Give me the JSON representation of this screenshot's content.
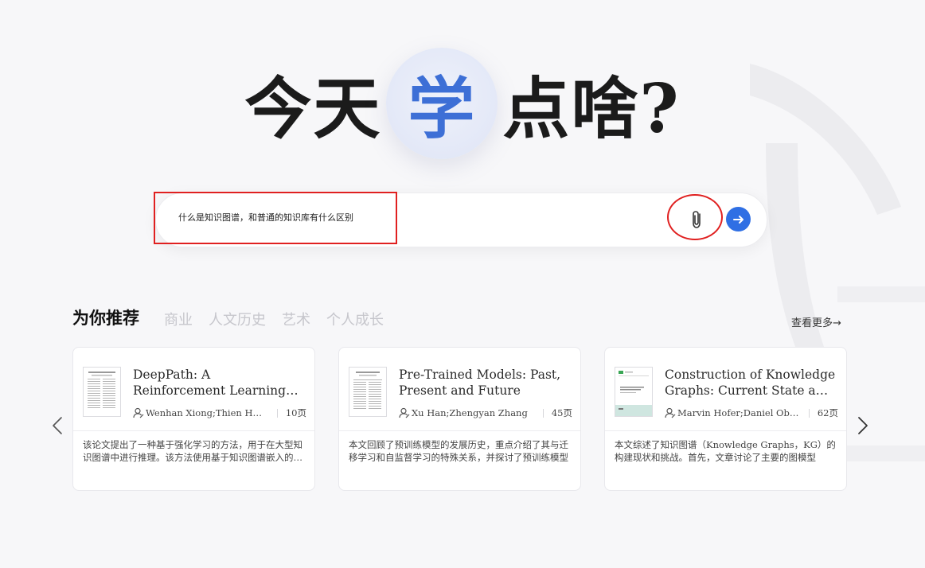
{
  "hero": {
    "prefix": "今天",
    "highlight": "学",
    "suffix": "点啥?",
    "highlight_color": "#3d6fd6"
  },
  "search": {
    "value": "什么是知识图谱，和普通的知识库有什么区别",
    "attach_icon": "paperclip-icon",
    "send_icon": "arrow-right-icon",
    "send_color": "#2f6fe4"
  },
  "recommend": {
    "title": "为你推荐",
    "tabs": [
      "商业",
      "人文历史",
      "艺术",
      "个人成长"
    ],
    "more": "查看更多→"
  },
  "cards": [
    {
      "title": "DeepPath: A Reinforcement Learning Method for Knowledge Graph Reasoning",
      "authors": "Wenhan Xiong;Thien Huu Nguyen",
      "pages": "10页",
      "summary": "该论文提出了一种基于强化学习的方法，用于在大型知识图谱中进行推理。该方法使用基于知识图谱嵌入的策略"
    },
    {
      "title": "Pre-Trained Models: Past, Present and Future",
      "authors": "Xu Han;Zhengyan Zhang",
      "pages": "45页",
      "summary": "本文回顾了预训练模型的发展历史，重点介绍了其与迁移学习和自监督学习的特殊关系，并探讨了预训练模型"
    },
    {
      "title": "Construction of Knowledge Graphs: Current State and Challenges",
      "authors": "Marvin Hofer;Daniel Obraczka",
      "pages": "62页",
      "summary": "本文综述了知识图谱（Knowledge Graphs，KG）的构建现状和挑战。首先，文章讨论了主要的图模型"
    }
  ],
  "annotation_color": "#e02020"
}
